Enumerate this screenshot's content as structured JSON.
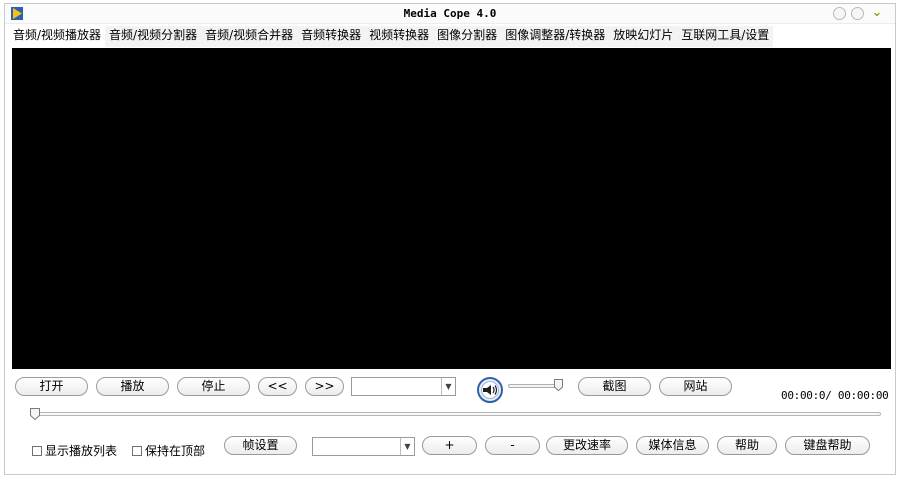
{
  "window": {
    "title": "Media Cope 4.0"
  },
  "tabs": [
    {
      "label": "音频/视频播放器"
    },
    {
      "label": "音频/视频分割器"
    },
    {
      "label": "音频/视频合并器"
    },
    {
      "label": "音频转换器"
    },
    {
      "label": "视频转换器"
    },
    {
      "label": "图像分割器"
    },
    {
      "label": "图像调整器/转换器"
    },
    {
      "label": "放映幻灯片"
    },
    {
      "label": "互联网工具/设置"
    }
  ],
  "controls": {
    "open": "打开",
    "play": "播放",
    "stop": "停止",
    "prev": "<<",
    "next": ">>",
    "screenshot": "截图",
    "website": "网站",
    "time": "00:00:0/ 00:00:00"
  },
  "bottom": {
    "show_playlist": "显示播放列表",
    "stay_on_top": "保持在顶部",
    "frame_settings": "帧设置",
    "plus": "+",
    "minus": "-",
    "change_speed": "更改速率",
    "media_info": "媒体信息",
    "help": "帮助",
    "keyboard_help": "键盘帮助"
  },
  "colors": {
    "video_bg": "#000000",
    "accent_green": "#8ea61c",
    "volume_icon_blue": "#2f63a8"
  },
  "icons": {
    "app": "play-logo-icon",
    "volume": "speaker-icon",
    "close": "check-chevron-icon"
  }
}
